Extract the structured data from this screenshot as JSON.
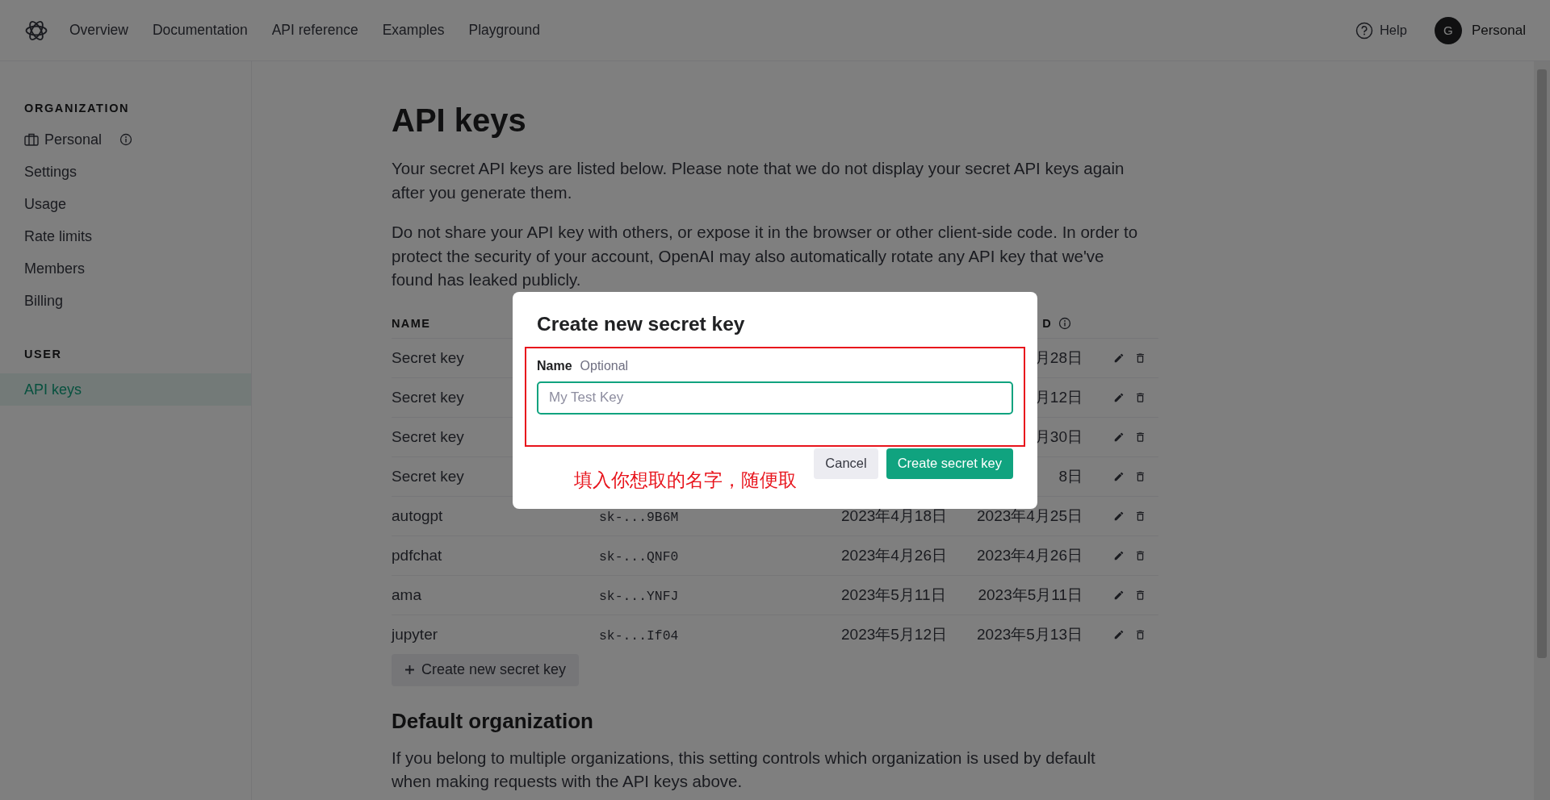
{
  "nav": {
    "links": [
      {
        "label": "Overview"
      },
      {
        "label": "Documentation"
      },
      {
        "label": "API reference"
      },
      {
        "label": "Examples"
      },
      {
        "label": "Playground"
      }
    ],
    "help": "Help",
    "avatar_letter": "G",
    "account": "Personal"
  },
  "sidebar": {
    "sections": [
      {
        "title": "ORGANIZATION",
        "items": [
          {
            "kind": "org",
            "label": "Personal",
            "selected": false
          },
          {
            "kind": "link",
            "label": "Settings",
            "selected": false
          },
          {
            "kind": "link",
            "label": "Usage",
            "selected": false
          },
          {
            "kind": "link",
            "label": "Rate limits",
            "selected": false
          },
          {
            "kind": "link",
            "label": "Members",
            "selected": false
          },
          {
            "kind": "link",
            "label": "Billing",
            "selected": false
          }
        ]
      },
      {
        "title": "USER",
        "items": [
          {
            "kind": "link",
            "label": "API keys",
            "selected": true
          }
        ]
      }
    ]
  },
  "main": {
    "title": "API keys",
    "paragraphs": [
      "Your secret API keys are listed below. Please note that we do not display your secret API keys again after you generate them.",
      "Do not share your API key with others, or expose it in the browser or other client-side code. In order to protect the security of your account, OpenAI may also automatically rotate any API key that we've found has leaked publicly."
    ],
    "table": {
      "headers": {
        "name": "NAME",
        "column_4": "D"
      },
      "rows": [
        {
          "name": "Secret key",
          "column_4": "月28日"
        },
        {
          "name": "Secret key",
          "column_4": "月12日"
        },
        {
          "name": "Secret key",
          "column_4": "月30日"
        },
        {
          "name": "Secret key",
          "column_4": "8日"
        },
        {
          "name": "autogpt",
          "column_2": "sk-...9B6M",
          "column_3": "2023年4月18日",
          "column_4": "2023年4月25日"
        },
        {
          "name": "pdfchat",
          "column_2": "sk-...QNF0",
          "column_3": "2023年4月26日",
          "column_4": "2023年4月26日"
        },
        {
          "name": "ama",
          "column_2": "sk-...YNFJ",
          "column_3": "2023年5月11日",
          "column_4": "2023年5月11日"
        },
        {
          "name": "jupyter",
          "column_2": "sk-...If04",
          "column_3": "2023年5月12日",
          "column_4": "2023年5月13日"
        }
      ]
    },
    "create_button": "Create new secret key",
    "default_org": {
      "heading": "Default organization",
      "text": "If you belong to multiple organizations, this setting controls which organization is used by default when making requests with the API keys above."
    }
  },
  "modal": {
    "title": "Create new secret key",
    "field": {
      "label": "Name",
      "hint": "Optional",
      "placeholder": "My Test Key"
    },
    "annotation": "填入你想取的名字，随便取",
    "buttons": [
      {
        "kind": "secondary",
        "label": "Cancel"
      },
      {
        "kind": "primary",
        "label": "Create secret key"
      }
    ]
  }
}
